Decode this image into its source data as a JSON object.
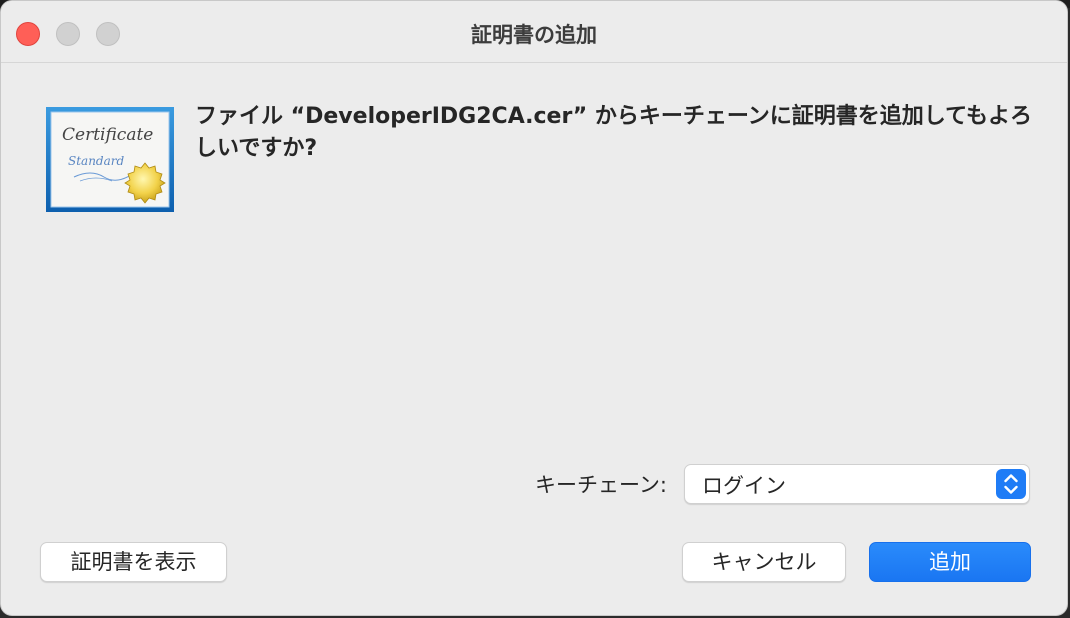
{
  "window": {
    "title": "証明書の追加"
  },
  "message": {
    "text": "ファイル “DeveloperIDG2CA.cer” からキーチェーンに証明書を追加してもよろしいですか?"
  },
  "certificate_icon": {
    "title_text": "Certificate",
    "subtitle_text": "Standard"
  },
  "keychain": {
    "label": "キーチェーン:",
    "selected": "ログイン"
  },
  "buttons": {
    "show_certificate": "証明書を表示",
    "cancel": "キャンセル",
    "add": "追加"
  },
  "colors": {
    "close": "#ff5f57",
    "accent": "#1f7cf6",
    "window_bg": "#ececec"
  },
  "icons": {
    "close": "close-dot",
    "minimize": "minimize-dot",
    "zoom": "zoom-dot",
    "stepper": "chevron-up-down-icon",
    "certificate": "certificate-icon"
  }
}
